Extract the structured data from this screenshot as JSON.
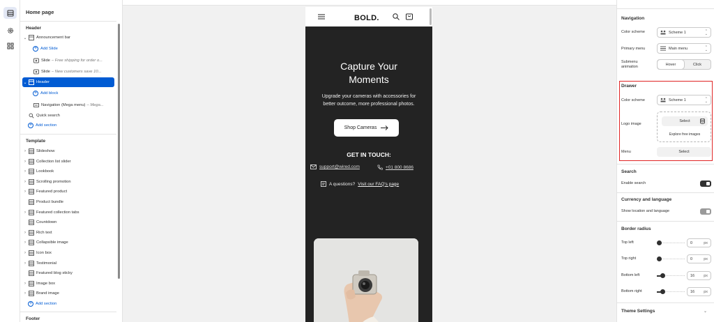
{
  "rail": {
    "icons": [
      "sections-icon",
      "settings-icon",
      "apps-icon"
    ]
  },
  "sidebar": {
    "title": "Home page",
    "header_section": "Header",
    "header_items": [
      {
        "label": "Announcement bar",
        "sub": ""
      },
      {
        "label": "Add Slide",
        "sub": ""
      },
      {
        "label": "Slide",
        "sub": "– Free shipping for order o..."
      },
      {
        "label": "Slide",
        "sub": "– New customers save 10..."
      },
      {
        "label": "Header",
        "sub": ""
      },
      {
        "label": "Add block",
        "sub": ""
      },
      {
        "label": "Navigation (Mega menu)",
        "sub": "– Mega..."
      },
      {
        "label": "Quick search",
        "sub": ""
      },
      {
        "label": "Add section",
        "sub": ""
      }
    ],
    "template_section": "Template",
    "template_items": [
      "Slideshow",
      "Collection list slider",
      "Lookbook",
      "Scrolling promotion",
      "Featured product",
      "Product bundle",
      "Featured collection tabs",
      "Countdown",
      "Rich text",
      "Collapsible image",
      "Icon box",
      "Testimonial",
      "Featured blog sticky",
      "Image box",
      "Brand image",
      "Add section"
    ],
    "footer_section": "Footer"
  },
  "preview": {
    "logo": "BOLD.",
    "hero_title_1": "Capture Your",
    "hero_title_2": "Moments",
    "hero_sub_1": "Upgrade your cameras with accessories for",
    "hero_sub_2": "better outcome, more professional photos.",
    "shop_button": "Shop Cameras",
    "get_in_touch": "GET IN TOUCH:",
    "email": "support@wired.com",
    "phone": "+01 800 8686",
    "faq_prefix": "A questions?",
    "faq_link": "Visit our FAQ's page"
  },
  "panel": {
    "navigation_title": "Navigation",
    "color_scheme_label": "Color scheme",
    "color_scheme_value": "Scheme 1",
    "primary_menu_label": "Primary menu",
    "primary_menu_value": "Main menu",
    "submenu_label_1": "Submenu",
    "submenu_label_2": "animation",
    "submenu_opt_hover": "Hover",
    "submenu_opt_click": "Click",
    "drawer_title": "Drawer",
    "drawer_color_label": "Color scheme",
    "drawer_color_value": "Scheme 1",
    "logo_image_label": "Logo image",
    "select_label": "Select",
    "explore_label": "Explore free images",
    "menu_label": "Menu",
    "menu_select": "Select",
    "search_title": "Search",
    "enable_search_label": "Enable search",
    "currency_title": "Currency and language",
    "show_location_label": "Show location and language",
    "border_title": "Border radius",
    "top_left_label": "Top left",
    "top_left_value": "0",
    "top_right_label": "Top right",
    "top_right_value": "0",
    "bottom_left_label": "Bottom left",
    "bottom_left_value": "16",
    "bottom_right_label": "Bottom right",
    "bottom_right_value": "16",
    "unit": "px",
    "theme_settings": "Theme Settings",
    "enable_search_on": true,
    "show_location_on": false
  },
  "colors": {
    "accent": "#005bd3",
    "highlight_box": "#e02424",
    "hero_bg": "#232323"
  }
}
